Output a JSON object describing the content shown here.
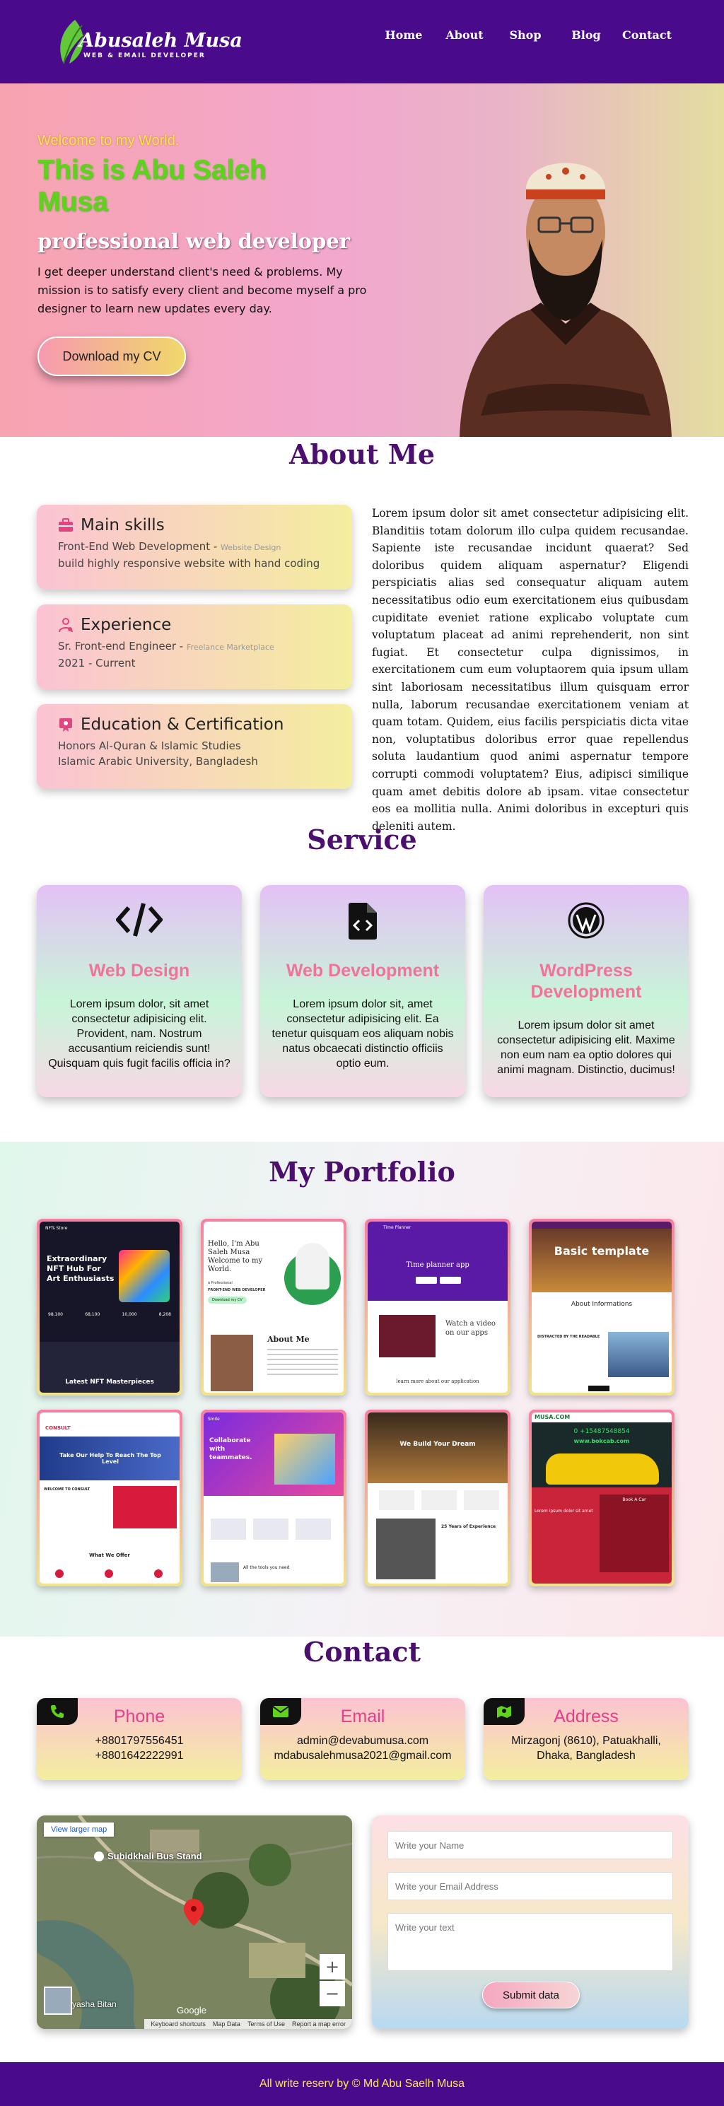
{
  "nav": {
    "logo_name": "Abusaleh Musa",
    "logo_sub": "WEB & EMAIL DEVELOPER",
    "items": [
      "Home",
      "About",
      "Shop",
      "Blog",
      "Contact"
    ]
  },
  "hero": {
    "welcome": "Welcome to my World.",
    "title": "This is Abu Saleh Musa",
    "role": "professional web developer",
    "description": "I get deeper understand client's need & problems. My mission is to satisfy every client and become myself a pro designer to learn new updates every day.",
    "cv_button": "Download my CV"
  },
  "about": {
    "title": "About Me",
    "cards": [
      {
        "title": "Main skills",
        "line1": "Front-End Web Development - ",
        "line1_small": "Website Design",
        "line2": "build highly responsive website with hand coding"
      },
      {
        "title": "Experience",
        "line1": "Sr. Front-end Engineer - ",
        "line1_small": "Freelance Marketplace",
        "line2": "2021 - Current"
      },
      {
        "title": "Education & Certification",
        "line1": "Honors Al-Quran & Islamic Studies",
        "line1_small": "",
        "line2": "Islamic Arabic University, Bangladesh"
      }
    ],
    "text": "Lorem ipsum dolor sit amet consectetur adipisicing elit. Blanditiis totam dolorum illo culpa quidem recusandae. Sapiente iste recusandae incidunt quaerat? Sed doloribus quidem aliquam aspernatur? Eligendi perspiciatis alias sed consequatur aliquam autem necessitatibus odio eum exercitationem eius quibusdam cupiditate eveniet ratione explicabo voluptate cum voluptatum placeat ad animi reprehenderit, non sint fugiat. Et consectetur culpa dignissimos, in exercitationem cum eum voluptaorem quia ipsum ullam sint laboriosam necessitatibus illum quisquam error nulla, laborum recusandae exercitationem veniam at quam totam. Quidem, eius facilis perspiciatis dicta vitae non, voluptatibus doloribus error quae repellendus soluta laudantium quod animi aspernatur tempore corrupti commodi voluptatem? Eius, adipisci similique quam amet debitis dolore ab ipsam. vitae consectetur eos ea mollitia nulla. Animi doloribus in excepturi quis deleniti autem."
  },
  "service": {
    "title": "Service",
    "cards": [
      {
        "title": "Web Design",
        "desc": "Lorem ipsum dolor, sit amet consectetur adipisicing elit. Provident, nam. Nostrum accusantium reiciendis sunt! Quisquam quis fugit facilis officia in?"
      },
      {
        "title": "Web Development",
        "desc": "Lorem ipsum dolor sit, amet consectetur adipisicing elit. Ea tenetur quisquam eos aliquam nobis natus obcaecati distinctio officiis optio eum."
      },
      {
        "title": "WordPress Development",
        "desc": "Lorem ipsum dolor sit amet consectetur adipisicing elit. Maxime non eum nam ea optio dolores qui animi magnam. Distinctio, ducimus!"
      }
    ]
  },
  "portfolio": {
    "title": "My Portfolio",
    "t1": {
      "brand": "NFTs Store",
      "hero": "Extraordinary NFT Hub For Art Enthusiasts",
      "stats": [
        "98,100",
        "68,100",
        "10,000",
        "8,208"
      ],
      "caption": "Latest NFT Masterpieces"
    },
    "t2": {
      "hello": "Hello, I'm Abu Saleh Musa Welcome to my World.",
      "role": "a Professional",
      "sub": "FRONT-END WEB DEVELOPER",
      "btn": "Download my CV",
      "about": "About Me"
    },
    "t3": {
      "brand": "Time Planner",
      "hero": "Time planner app",
      "video": "Watch a video on our apps",
      "footer": "learn more about our application"
    },
    "t4": {
      "hero": "Basic template",
      "section": "About Informations",
      "sub": "DISTRACTED BY THE READABLE"
    },
    "t5": {
      "brand": "CONSULT",
      "hero": "Take Our Help To Reach The Top Level",
      "welcome": "WELCOME TO CONSULT",
      "offer": "What We Offer"
    },
    "t6": {
      "brand": "Smile",
      "hero": "Collaborate with teammates.",
      "cta": "All the tools you need"
    },
    "t7": {
      "hero": "We Build Your Dream",
      "exp": "25 Years of Experience"
    },
    "t8": {
      "brand": "MUSA.COM",
      "phone": "0 +15487548854",
      "web": "www.bokcab.com",
      "book": "Book A Car",
      "headline": "Lorem ipsum dolor sit amet"
    }
  },
  "contact": {
    "title": "Contact",
    "cards": [
      {
        "title": "Phone",
        "lines": [
          "+8801797556451",
          "+8801642222991"
        ]
      },
      {
        "title": "Email",
        "lines": [
          "admin@devabumusa.com",
          "mdabusalehmusa2021@gmail.com"
        ]
      },
      {
        "title": "Address",
        "lines": [
          "Mirzagonj (8610), Patuakhalli,",
          "Dhaka, Bangladesh"
        ]
      }
    ],
    "map": {
      "view_larger": "View larger map",
      "place": "Subidkhali Bus Stand",
      "place2": "yasha Bitan",
      "google": "Google",
      "attr": [
        "Keyboard shortcuts",
        "Map Data",
        "Terms of Use",
        "Report a map error"
      ],
      "zoom_in": "+",
      "zoom_out": "−"
    },
    "form": {
      "name_placeholder": "Write your Name",
      "email_placeholder": "Write your Email Address",
      "text_placeholder": "Write your text",
      "submit": "Submit data"
    }
  },
  "footer": {
    "text": "All write reserv by © Md Abu Saelh Musa"
  },
  "colors": {
    "nav": "#4a0a8c",
    "heading": "#4b0f6e",
    "accent": "#f0739a",
    "green": "#5fd21b",
    "yellow": "#ffe94a"
  }
}
